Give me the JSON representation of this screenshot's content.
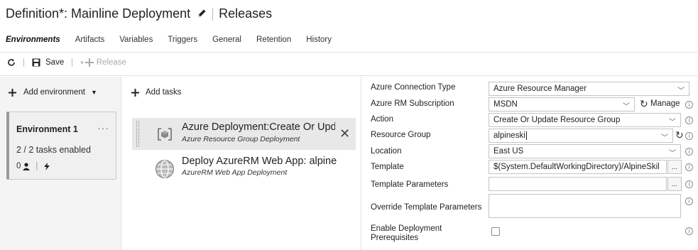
{
  "header": {
    "title": "Definition*: Mainline Deployment",
    "section": "Releases"
  },
  "tabs": [
    "Environments",
    "Artifacts",
    "Variables",
    "Triggers",
    "General",
    "Retention",
    "History"
  ],
  "toolbar": {
    "save_label": "Save",
    "release_label": "Release"
  },
  "environments": {
    "add_label": "Add environment",
    "card": {
      "name": "Environment 1",
      "more": "···",
      "tasks_enabled": "2 / 2 tasks enabled",
      "approvers_count": "0"
    }
  },
  "tasks": {
    "add_label": "Add tasks",
    "items": [
      {
        "title": "Azure Deployment:Create Or Upd",
        "subtitle": "Azure Resource Group Deployment"
      },
      {
        "title": "Deploy AzureRM Web App: alpine",
        "subtitle": "AzureRM Web App Deployment"
      }
    ]
  },
  "form": {
    "connection_type": {
      "label": "Azure Connection Type",
      "value": "Azure Resource Manager"
    },
    "subscription": {
      "label": "Azure RM Subscription",
      "value": "MSDN",
      "manage_label": "Manage"
    },
    "action": {
      "label": "Action",
      "value": "Create Or Update Resource Group"
    },
    "resource_group": {
      "label": "Resource Group",
      "value": "alpineski"
    },
    "location": {
      "label": "Location",
      "value": "East US"
    },
    "template": {
      "label": "Template",
      "value": "$(System.DefaultWorkingDirectory)/AlpineSkil"
    },
    "template_parameters": {
      "label": "Template Parameters",
      "value": ""
    },
    "override_parameters": {
      "label": "Override Template Parameters",
      "value": ""
    },
    "enable_prereq": {
      "label_line1": "Enable Deployment",
      "label_line2": "Prerequisites",
      "checked": false
    },
    "browse_label": "..."
  }
}
